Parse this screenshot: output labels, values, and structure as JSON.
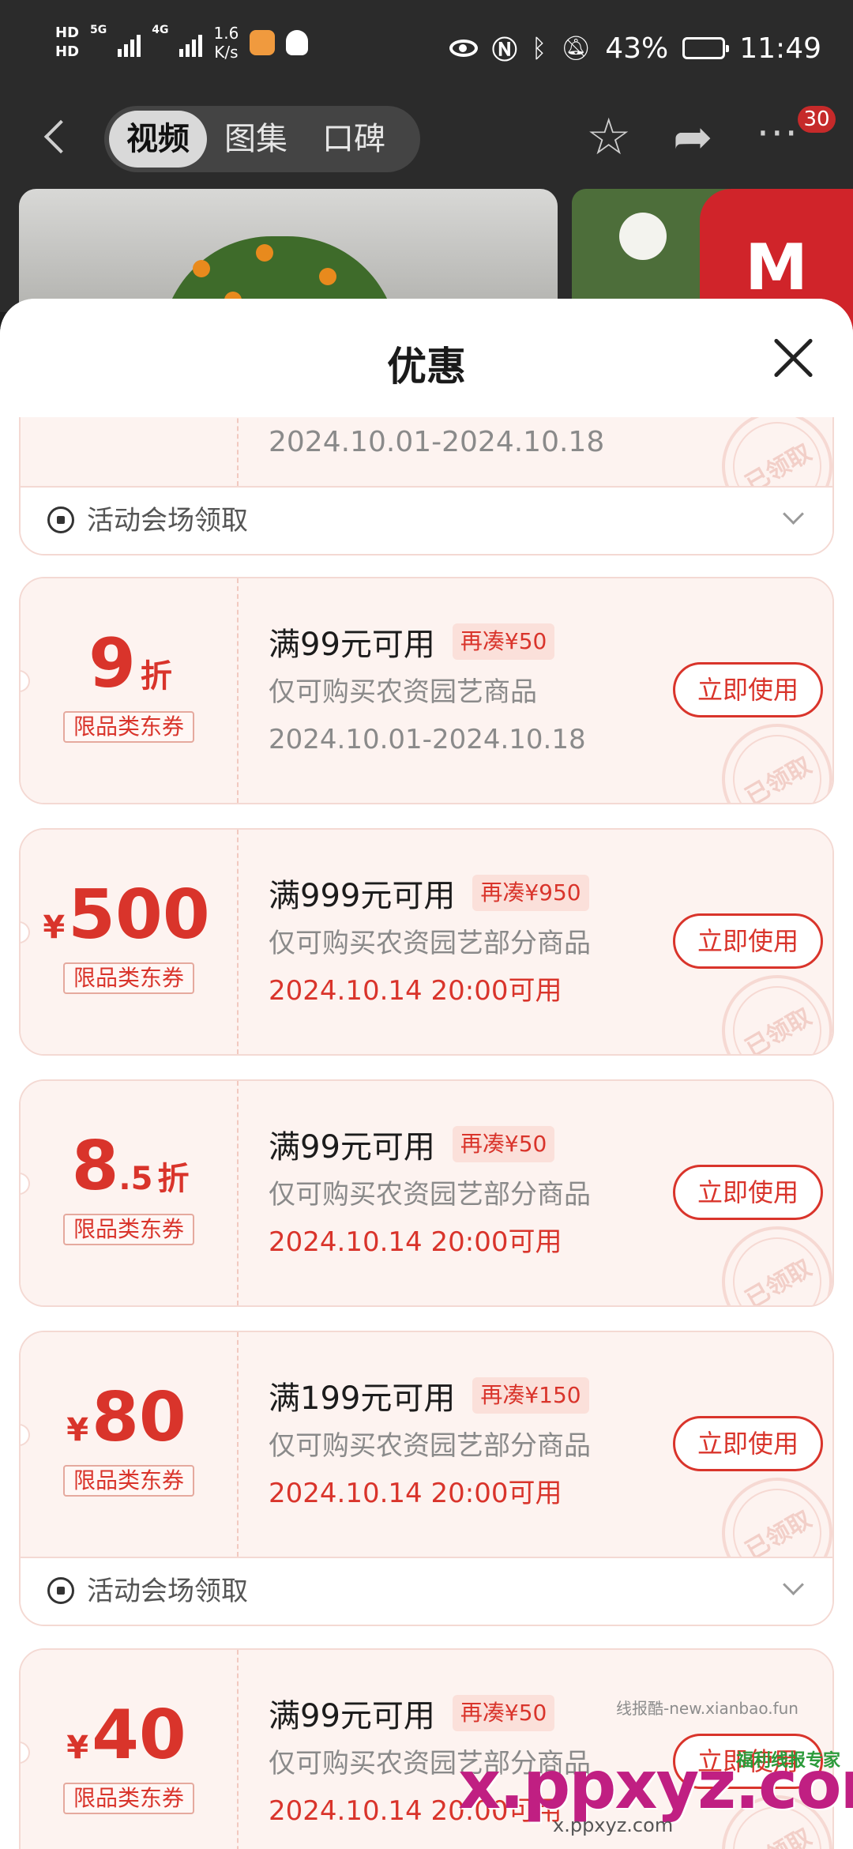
{
  "status_bar": {
    "hd1": "HD",
    "hd2": "HD",
    "net1": "5G",
    "net2": "4G",
    "speed_value": "1.6",
    "speed_unit": "K/s",
    "battery": "43%",
    "time": "11:49",
    "icons": [
      "eye-icon",
      "nfc-icon",
      "bluetooth-icon",
      "mute-icon",
      "battery-icon"
    ]
  },
  "nav": {
    "tabs": [
      {
        "label": "视频",
        "active": true
      },
      {
        "label": "图集",
        "active": false
      },
      {
        "label": "口碑",
        "active": false
      }
    ],
    "more_badge": "30"
  },
  "sheet": {
    "title": "优惠",
    "venue_label": "活动会场领取",
    "stamp_text": "已领取",
    "partial_coupon": {
      "date": "2024.10.01-2024.10.18"
    },
    "coupons": [
      {
        "symbol": "",
        "amount": "9",
        "decimal": "",
        "unit": "折",
        "type_tag": "限品类东券",
        "threshold": "满99元可用",
        "gap_tag": "再凑¥50",
        "scope": "仅可购买农资园艺商品",
        "date": "2024.10.01-2024.10.18",
        "date_upcoming": false,
        "button": "立即使用"
      },
      {
        "symbol": "¥",
        "amount": "500",
        "decimal": "",
        "unit": "",
        "type_tag": "限品类东券",
        "threshold": "满999元可用",
        "gap_tag": "再凑¥950",
        "scope": "仅可购买农资园艺部分商品",
        "date": "2024.10.14 20:00可用",
        "date_upcoming": true,
        "button": "立即使用"
      },
      {
        "symbol": "",
        "amount": "8",
        "decimal": ".5",
        "unit": "折",
        "type_tag": "限品类东券",
        "threshold": "满99元可用",
        "gap_tag": "再凑¥50",
        "scope": "仅可购买农资园艺部分商品",
        "date": "2024.10.14 20:00可用",
        "date_upcoming": true,
        "button": "立即使用"
      },
      {
        "symbol": "¥",
        "amount": "80",
        "decimal": "",
        "unit": "",
        "type_tag": "限品类东券",
        "threshold": "满199元可用",
        "gap_tag": "再凑¥150",
        "scope": "仅可购买农资园艺部分商品",
        "date": "2024.10.14 20:00可用",
        "date_upcoming": true,
        "button": "立即使用"
      },
      {
        "symbol": "¥",
        "amount": "40",
        "decimal": "",
        "unit": "",
        "type_tag": "限品类东券",
        "threshold": "满99元可用",
        "gap_tag": "再凑¥50",
        "scope": "仅可购买农资园艺部分商品",
        "date": "2024.10.14 20:00可用",
        "date_upcoming": true,
        "button": "立即使用"
      }
    ]
  },
  "watermark": {
    "site_text": "线报酷-new.xianbao.fun",
    "logo": "x.ppxyz.com",
    "sub": "x.ppxyz.com",
    "badge": "福利线报专家"
  },
  "colors": {
    "accent": "#d9342b",
    "coupon_bg": "#fdf3f0",
    "border": "#f4d9d3"
  }
}
